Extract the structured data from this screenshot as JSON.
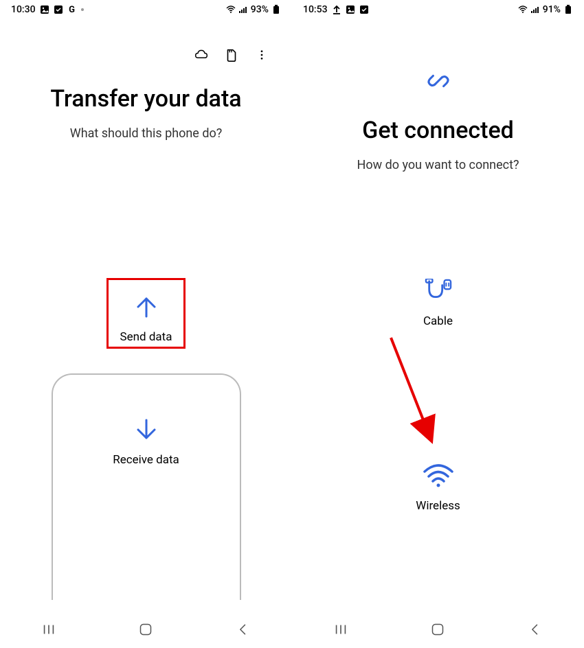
{
  "left": {
    "status": {
      "time": "10:30",
      "battery": "93%"
    },
    "heading": "Transfer your data",
    "subheading": "What should this phone do?",
    "send_label": "Send data",
    "receive_label": "Receive data"
  },
  "right": {
    "status": {
      "time": "10:53",
      "battery": "91%"
    },
    "heading": "Get connected",
    "subheading": "How do you want to connect?",
    "cable_label": "Cable",
    "wireless_label": "Wireless"
  }
}
